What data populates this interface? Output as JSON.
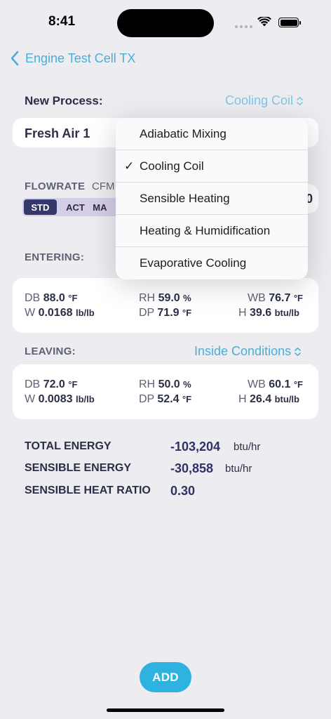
{
  "status_bar": {
    "time": "8:41"
  },
  "nav": {
    "back_label": "Engine Test Cell TX"
  },
  "new_process": {
    "label": "New Process:",
    "selected": "Cooling Coil"
  },
  "source": {
    "name": "Fresh Air 1"
  },
  "flowrate": {
    "label": "FLOWRATE",
    "unit": "CFM",
    "segments": [
      "STD",
      "ACT",
      "MA"
    ],
    "active": "STD",
    "partial_value_char": "0"
  },
  "dropdown": {
    "items": [
      "Adiabatic Mixing",
      "Cooling Coil",
      "Sensible Heating",
      "Heating & Humidification",
      "Evaporative Cooling"
    ],
    "checkmark": "✓",
    "checked_index": 1
  },
  "entering": {
    "label": "ENTERING:",
    "db": {
      "k": "DB",
      "v": "88.0",
      "u": "°F"
    },
    "rh": {
      "k": "RH",
      "v": "59.0",
      "u": "%"
    },
    "wb": {
      "k": "WB",
      "v": "76.7",
      "u": "°F"
    },
    "w": {
      "k": "W",
      "v": "0.0168",
      "u": "lb/lb"
    },
    "dp": {
      "k": "DP",
      "v": "71.9",
      "u": "°F"
    },
    "h": {
      "k": "H",
      "v": "39.6",
      "u": "btu/lb"
    }
  },
  "leaving": {
    "label": "LEAVING:",
    "selector": "Inside Conditions",
    "db": {
      "k": "DB",
      "v": "72.0",
      "u": "°F"
    },
    "rh": {
      "k": "RH",
      "v": "50.0",
      "u": "%"
    },
    "wb": {
      "k": "WB",
      "v": "60.1",
      "u": "°F"
    },
    "w": {
      "k": "W",
      "v": "0.0083",
      "u": "lb/lb"
    },
    "dp": {
      "k": "DP",
      "v": "52.4",
      "u": "°F"
    },
    "h": {
      "k": "H",
      "v": "26.4",
      "u": "btu/lb"
    }
  },
  "results": {
    "total_energy": {
      "label": "TOTAL ENERGY",
      "value": "-103,204",
      "unit": "btu/hr"
    },
    "sensible_energy": {
      "label": "SENSIBLE ENERGY",
      "value": "-30,858",
      "unit": "btu/hr"
    },
    "shr": {
      "label": "SENSIBLE HEAT RATIO",
      "value": "0.30"
    }
  },
  "add_button": {
    "label": "ADD"
  },
  "colors": {
    "accent": "#2eb3e0",
    "link": "#4aaed9",
    "segment_active": "#34386b",
    "segment_bg": "#d6cde6",
    "value_text": "#2f3266"
  },
  "icons": [
    "back-chevron-icon",
    "up-down-chevron-icon",
    "wifi-icon",
    "battery-icon",
    "cellular-signal-icon",
    "checkmark-icon"
  ]
}
